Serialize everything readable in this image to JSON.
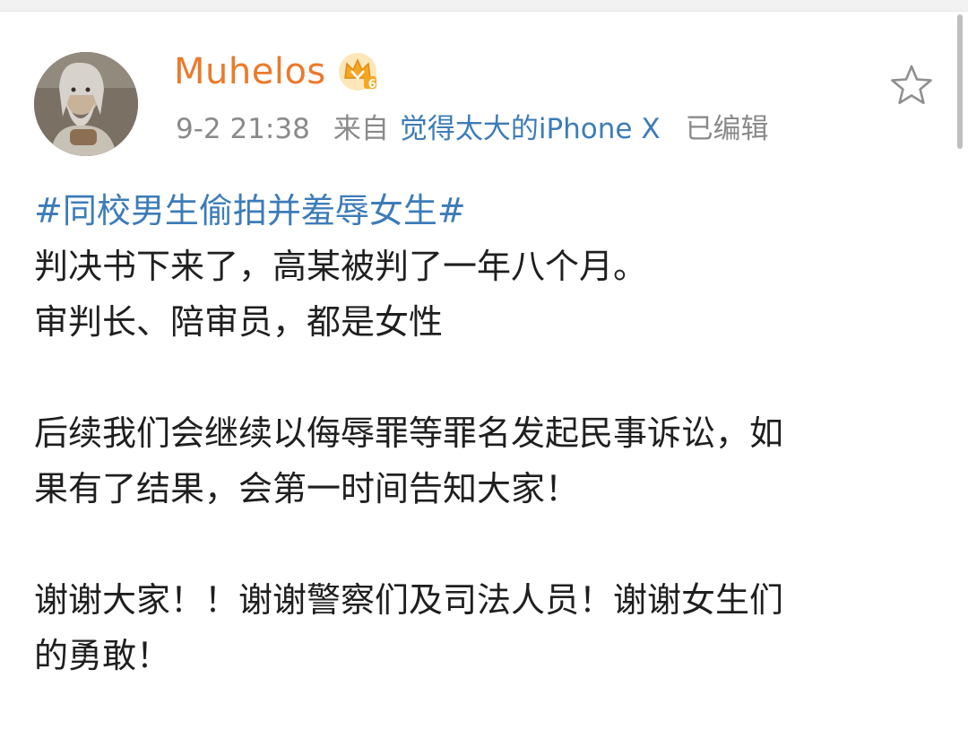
{
  "post": {
    "author": {
      "name": "Muhelos",
      "vip_badge": "crown-icon",
      "vip_level": "6"
    },
    "meta": {
      "time": "9-2 21:38",
      "from_label": "来自",
      "device": "觉得太大的iPhone X",
      "edited": "已编辑"
    },
    "favorite_icon": "star-outline-icon",
    "hashtag": "#同校男生偷拍并羞辱女生#",
    "lines": [
      "判决书下来了，高某被判了一年八个月。",
      "审判长、陪审员，都是女性",
      "后续我们会继续以侮辱罪等罪名发起民事诉讼，如",
      "果有了结果，会第一时间告知大家！",
      "谢谢大家！！谢谢警察们及司法人员！谢谢女生们",
      "的勇敢！"
    ]
  },
  "colors": {
    "username": "#eb7a2d",
    "link": "#3d7cb8",
    "meta": "#8a8a8a",
    "text": "#1f1f1f",
    "badge": "#f5a623"
  }
}
